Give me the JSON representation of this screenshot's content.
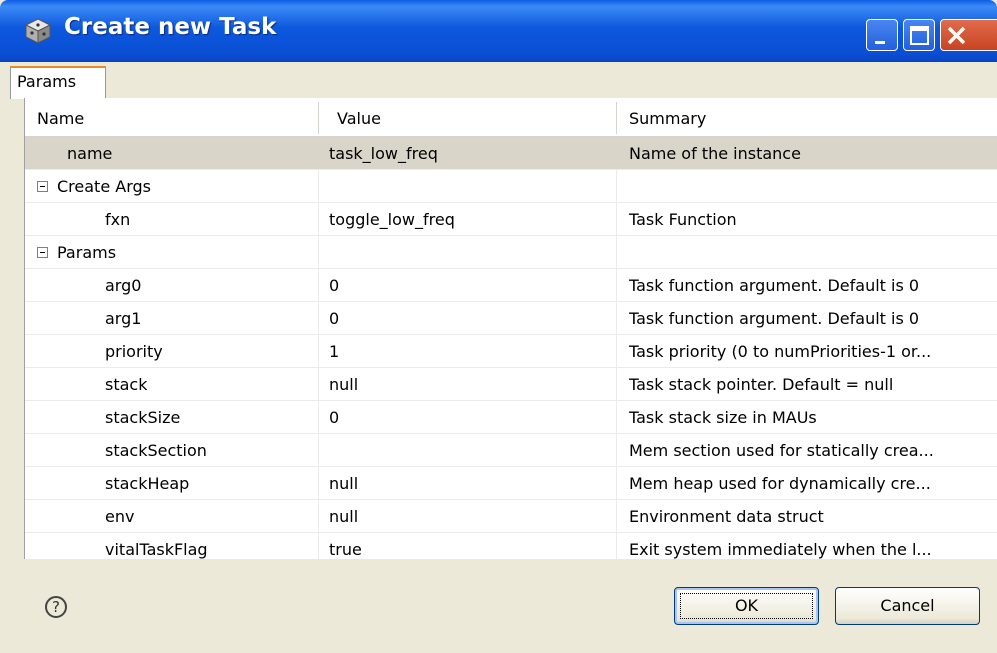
{
  "window": {
    "title": "Create new Task"
  },
  "tabs": [
    {
      "label": "Params",
      "active": true
    }
  ],
  "table": {
    "columns": [
      "Name",
      "Value",
      "Summary"
    ],
    "rows": [
      {
        "name": "name",
        "value": "task_low_freq",
        "summary": "Name of the instance",
        "selected": true,
        "indent": 1
      },
      {
        "name": "Create Args",
        "value": "",
        "summary": "",
        "group": true,
        "expanded": true
      },
      {
        "name": "fxn",
        "value": "toggle_low_freq",
        "summary": "Task Function",
        "indent": 2
      },
      {
        "name": "Params",
        "value": "",
        "summary": "",
        "group": true,
        "expanded": true
      },
      {
        "name": "arg0",
        "value": "0",
        "summary": "Task function argument. Default is 0",
        "indent": 2
      },
      {
        "name": "arg1",
        "value": "0",
        "summary": "Task function argument. Default is 0",
        "indent": 2
      },
      {
        "name": "priority",
        "value": "1",
        "summary": "Task priority (0 to numPriorities-1 or...",
        "indent": 2
      },
      {
        "name": "stack",
        "value": "null",
        "summary": "Task stack pointer. Default = null",
        "indent": 2
      },
      {
        "name": "stackSize",
        "value": "0",
        "summary": "Task stack size in MAUs",
        "indent": 2
      },
      {
        "name": "stackSection",
        "value": "",
        "summary": "Mem section used for statically crea...",
        "indent": 2
      },
      {
        "name": "stackHeap",
        "value": "null",
        "summary": "Mem heap used for dynamically cre...",
        "indent": 2
      },
      {
        "name": "env",
        "value": "null",
        "summary": "Environment data struct",
        "indent": 2
      },
      {
        "name": "vitalTaskFlag",
        "value": "true",
        "summary": "Exit system immediately when the l...",
        "indent": 2
      }
    ]
  },
  "footer": {
    "ok_label": "OK",
    "cancel_label": "Cancel",
    "help_glyph": "?"
  },
  "colors": {
    "titlebar": "#0a4fd4",
    "selected_row": "#d9d5c9",
    "dialog_bg": "#ece9d8",
    "tab_accent": "#e68b2c"
  },
  "icons": [
    "app-cube-icon",
    "minimize-icon",
    "maximize-icon",
    "close-icon",
    "collapse-icon",
    "help-icon"
  ]
}
